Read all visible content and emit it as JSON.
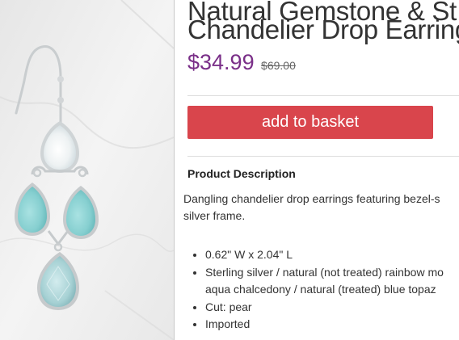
{
  "product": {
    "title_line1": "Natural Gemstone & St",
    "title_line2": "Chandelier Drop Earring",
    "price": "$34.99",
    "old_price": "$69.00"
  },
  "buttons": {
    "add_to_basket": "add to basket"
  },
  "description": {
    "heading": "Product Description",
    "text_line1": "Dangling chandelier drop earrings featuring bezel-s",
    "text_line2": "silver frame.",
    "features": [
      {
        "line1": "0.62\" W x 2.04\" L"
      },
      {
        "line1": "Sterling silver / natural (not treated) rainbow mo",
        "line2": "aqua chalcedony / natural (treated) blue topaz"
      },
      {
        "line1": "Cut: pear"
      },
      {
        "line1": "Imported"
      }
    ]
  },
  "colors": {
    "price": "#7a2f88",
    "button": "#d9454c",
    "aqua_stone": "#8fd3d4",
    "topaz_stone": "#a9d3d6",
    "moonstone": "#eef3f4"
  }
}
